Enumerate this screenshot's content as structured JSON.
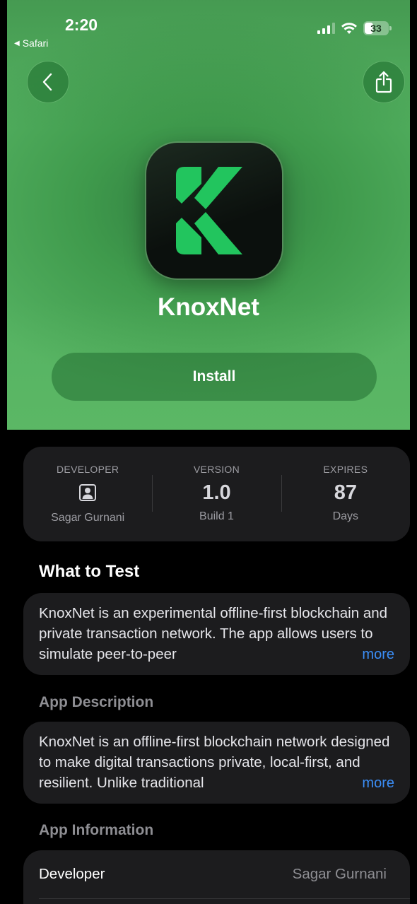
{
  "status_bar": {
    "time": "2:20",
    "back_app": "Safari",
    "battery": "33"
  },
  "nav": {
    "back_icon": "chevron-left-icon",
    "share_icon": "share-icon"
  },
  "app": {
    "name": "KnoxNet",
    "install_label": "Install",
    "brand_color": "#22c55e"
  },
  "info": {
    "developer": {
      "label": "DEVELOPER",
      "icon": "person-icon",
      "sub": "Sagar Gurnani"
    },
    "version": {
      "label": "VERSION",
      "value": "1.0",
      "sub": "Build 1"
    },
    "expires": {
      "label": "EXPIRES",
      "value": "87",
      "sub": "Days"
    }
  },
  "what_to_test": {
    "title": "What to Test",
    "text": "KnoxNet is an experimental offline-first blockchain and private transaction network. The app allows users to simulate peer-to-peer",
    "more": "more"
  },
  "app_description": {
    "title": "App Description",
    "text": "KnoxNet is an offline-first blockchain network designed to make digital transactions private, local-first, and resilient. Unlike traditional",
    "more": "more"
  },
  "app_information": {
    "title": "App Information",
    "rows": [
      {
        "key": "Developer",
        "value": "Sagar Gurnani"
      }
    ]
  },
  "colors": {
    "link": "#3b8ef7",
    "card_bg": "#1c1c1e"
  }
}
